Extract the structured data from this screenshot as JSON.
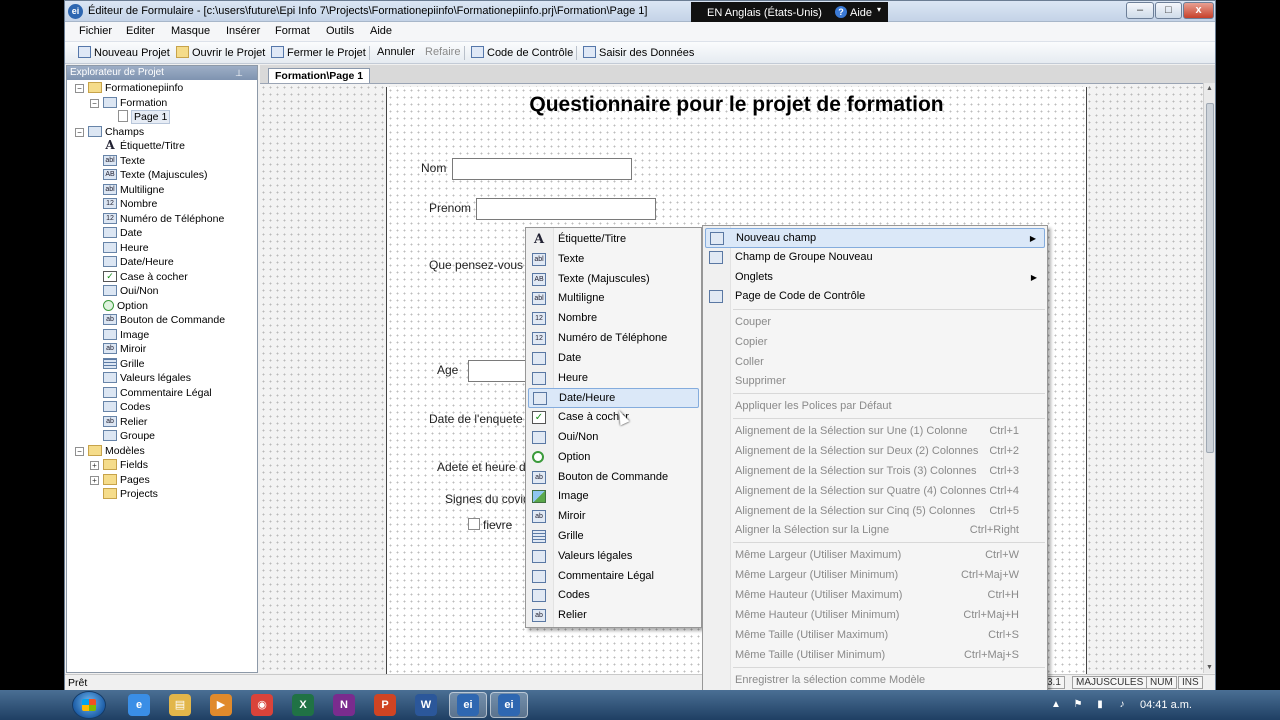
{
  "window": {
    "title": "Éditeur de Formulaire - [c:\\users\\future\\Epi Info 7\\Projects\\Formationepiinfo\\Formationepiinfo.prj\\Formation\\Page 1]",
    "app_icon_text": "ei",
    "minimize": "–",
    "maximize": "□",
    "close": "x"
  },
  "language_bar": {
    "language": "EN Anglais (États-Unis)",
    "help_label": "Aide",
    "help_icon": "?",
    "arrow": "▾"
  },
  "menubar": {
    "items": [
      "Fichier",
      "Editer",
      "Masque",
      "Insérer",
      "Format",
      "Outils",
      "Aide"
    ]
  },
  "toolbar": {
    "new_project": "Nouveau Projet",
    "open_project": "Ouvrir le Projet",
    "close_project": "Fermer le Projet",
    "undo": "Annuler",
    "redo": "Refaire",
    "check_code": "Code de Contrôle",
    "enter_data": "Saisir des Données"
  },
  "explorer": {
    "header": "Explorateur de Projet",
    "pin": "⊥",
    "tree": [
      {
        "label": "Formationepiinfo",
        "icon": "folder-icon",
        "glyph": ""
      },
      {
        "label": "Formation",
        "icon": "form-icon",
        "glyph": ""
      },
      {
        "label": "Page 1",
        "icon": "page-icon",
        "glyph": ""
      },
      {
        "label": "Champs",
        "icon": "fields-icon",
        "glyph": ""
      },
      {
        "label": "Étiquette/Titre",
        "icon": "label-icon",
        "glyph": "A"
      },
      {
        "label": "Texte",
        "icon": "text-icon",
        "glyph": "abl"
      },
      {
        "label": "Texte (Majuscules)",
        "icon": "uppercase-text-icon",
        "glyph": "AB"
      },
      {
        "label": "Multiligne",
        "icon": "multiline-icon",
        "glyph": "abl"
      },
      {
        "label": "Nombre",
        "icon": "number-icon",
        "glyph": "12"
      },
      {
        "label": "Numéro de Téléphone",
        "icon": "phone-icon",
        "glyph": "12"
      },
      {
        "label": "Date",
        "icon": "date-icon",
        "glyph": ""
      },
      {
        "label": "Heure",
        "icon": "time-icon",
        "glyph": ""
      },
      {
        "label": "Date/Heure",
        "icon": "datetime-icon",
        "glyph": ""
      },
      {
        "label": "Case à cocher",
        "icon": "checkbox-icon",
        "glyph": "✓"
      },
      {
        "label": "Oui/Non",
        "icon": "yes-no-icon",
        "glyph": ""
      },
      {
        "label": "Option",
        "icon": "option-icon",
        "glyph": ""
      },
      {
        "label": "Bouton de Commande",
        "icon": "command-button-icon",
        "glyph": "ab"
      },
      {
        "label": "Image",
        "icon": "image-icon",
        "glyph": ""
      },
      {
        "label": "Miroir",
        "icon": "mirror-icon",
        "glyph": "ab"
      },
      {
        "label": "Grille",
        "icon": "grid-icon",
        "glyph": ""
      },
      {
        "label": "Valeurs légales",
        "icon": "legal-values-icon",
        "glyph": ""
      },
      {
        "label": "Commentaire Légal",
        "icon": "comment-legal-icon",
        "glyph": ""
      },
      {
        "label": "Codes",
        "icon": "codes-icon",
        "glyph": ""
      },
      {
        "label": "Relier",
        "icon": "relate-icon",
        "glyph": "ab"
      },
      {
        "label": "Groupe",
        "icon": "group-icon",
        "glyph": ""
      },
      {
        "label": "Modèles",
        "icon": "templates-folder-icon",
        "glyph": ""
      },
      {
        "label": "Fields",
        "icon": "folder-icon",
        "glyph": ""
      },
      {
        "label": "Pages",
        "icon": "folder-icon",
        "glyph": ""
      },
      {
        "label": "Projects",
        "icon": "folder-icon",
        "glyph": ""
      }
    ]
  },
  "document": {
    "tab": "Formation\\Page 1",
    "form_title": "Questionnaire pour le projet de formation",
    "labels": {
      "nom": "Nom",
      "prenom": "Prenom",
      "que_pensez": "Que pensez-vous d",
      "age": "Age",
      "date_enquete": "Date de l'enquete",
      "adete": "Adete et heure d",
      "signes": "Signes du covid",
      "fievre": "fievre"
    }
  },
  "field_menu": {
    "items": [
      {
        "label": "Étiquette/Titre",
        "icon": "label-icon",
        "glyph": "A"
      },
      {
        "label": "Texte",
        "icon": "text-icon",
        "glyph": "abl"
      },
      {
        "label": "Texte (Majuscules)",
        "icon": "uppercase-text-icon",
        "glyph": "AB"
      },
      {
        "label": "Multiligne",
        "icon": "multiline-icon",
        "glyph": "abl"
      },
      {
        "label": "Nombre",
        "icon": "number-icon",
        "glyph": "12"
      },
      {
        "label": "Numéro de Téléphone",
        "icon": "phone-icon",
        "glyph": "12"
      },
      {
        "label": "Date",
        "icon": "date-icon",
        "glyph": ""
      },
      {
        "label": "Heure",
        "icon": "time-icon",
        "glyph": ""
      },
      {
        "label": "Date/Heure",
        "icon": "datetime-icon",
        "glyph": ""
      },
      {
        "label": "Case à cocher",
        "icon": "checkbox-icon",
        "glyph": "✓"
      },
      {
        "label": "Oui/Non",
        "icon": "yes-no-icon",
        "glyph": ""
      },
      {
        "label": "Option",
        "icon": "option-icon",
        "glyph": ""
      },
      {
        "label": "Bouton de Commande",
        "icon": "command-button-icon",
        "glyph": "ab"
      },
      {
        "label": "Image",
        "icon": "image-icon",
        "glyph": ""
      },
      {
        "label": "Miroir",
        "icon": "mirror-icon",
        "glyph": "ab"
      },
      {
        "label": "Grille",
        "icon": "grid-icon",
        "glyph": ""
      },
      {
        "label": "Valeurs légales",
        "icon": "legal-values-icon",
        "glyph": ""
      },
      {
        "label": "Commentaire Légal",
        "icon": "comment-legal-icon",
        "glyph": ""
      },
      {
        "label": "Codes",
        "icon": "codes-icon",
        "glyph": ""
      },
      {
        "label": "Relier",
        "icon": "relate-icon",
        "glyph": "ab"
      }
    ],
    "highlighted": "Date/Heure"
  },
  "context_menu": {
    "items": [
      {
        "label": "Nouveau champ",
        "shortcut": "",
        "submenu": true,
        "enabled": true,
        "highlighted": true,
        "icon": "new-field-icon"
      },
      {
        "label": "Champ de Groupe Nouveau",
        "shortcut": "",
        "submenu": false,
        "enabled": true,
        "icon": "group-field-icon"
      },
      {
        "label": "Onglets",
        "shortcut": "",
        "submenu": true,
        "enabled": true,
        "icon": ""
      },
      {
        "label": "Page de Code de Contrôle",
        "shortcut": "",
        "submenu": false,
        "enabled": true,
        "icon": "check-code-icon"
      },
      {
        "label": "Couper",
        "shortcut": "",
        "enabled": false
      },
      {
        "label": "Copier",
        "shortcut": "",
        "enabled": false
      },
      {
        "label": "Coller",
        "shortcut": "",
        "enabled": false
      },
      {
        "label": "Supprimer",
        "shortcut": "",
        "enabled": false
      },
      {
        "label": "Appliquer les Polices par Défaut",
        "shortcut": "",
        "enabled": false
      },
      {
        "label": "Alignement de la Sélection sur Une (1) Colonne",
        "shortcut": "Ctrl+1",
        "enabled": false
      },
      {
        "label": "Alignement de la Sélection sur Deux (2) Colonnes",
        "shortcut": "Ctrl+2",
        "enabled": false
      },
      {
        "label": "Alignement de la Sélection sur Trois (3) Colonnes",
        "shortcut": "Ctrl+3",
        "enabled": false
      },
      {
        "label": "Alignement de la Sélection sur Quatre (4) Colonnes",
        "shortcut": "Ctrl+4",
        "enabled": false
      },
      {
        "label": "Alignement de la Sélection sur Cinq (5) Colonnes",
        "shortcut": "Ctrl+5",
        "enabled": false
      },
      {
        "label": "Aligner la Sélection sur la Ligne",
        "shortcut": "Ctrl+Right",
        "enabled": false
      },
      {
        "label": "Même Largeur (Utiliser Maximum)",
        "shortcut": "Ctrl+W",
        "enabled": false
      },
      {
        "label": "Même Largeur (Utiliser Minimum)",
        "shortcut": "Ctrl+Maj+W",
        "enabled": false
      },
      {
        "label": "Même Hauteur (Utiliser Maximum)",
        "shortcut": "Ctrl+H",
        "enabled": false
      },
      {
        "label": "Même Hauteur (Utiliser Minimum)",
        "shortcut": "Ctrl+Maj+H",
        "enabled": false
      },
      {
        "label": "Même Taille (Utiliser Maximum)",
        "shortcut": "Ctrl+S",
        "enabled": false
      },
      {
        "label": "Même Taille (Utiliser Minimum)",
        "shortcut": "Ctrl+Maj+S",
        "enabled": false
      },
      {
        "label": "Enregistrer la sélection comme Modèle",
        "shortcut": "",
        "enabled": false
      }
    ]
  },
  "status_bar": {
    "status": "Prêt",
    "version": "3.1",
    "caps": "MAJUSCULES",
    "num": "NUM",
    "ins": "INS"
  },
  "taskbar": {
    "apps": [
      {
        "name": "internet-explorer-icon",
        "glyph": "e",
        "color": "#3a8ee6"
      },
      {
        "name": "file-explorer-icon",
        "glyph": "▤",
        "color": "#e2b64a"
      },
      {
        "name": "media-player-icon",
        "glyph": "▶",
        "color": "#e08a2c"
      },
      {
        "name": "chrome-icon",
        "glyph": "◉",
        "color": "#d9433a"
      },
      {
        "name": "excel-icon",
        "glyph": "X",
        "color": "#207245"
      },
      {
        "name": "onenote-icon",
        "glyph": "N",
        "color": "#7a2c8e"
      },
      {
        "name": "powerpoint-icon",
        "glyph": "P",
        "color": "#d04423"
      },
      {
        "name": "word-icon",
        "glyph": "W",
        "color": "#2b579a"
      },
      {
        "name": "epi-info-icon",
        "glyph": "ei",
        "color": "#2e67b1"
      },
      {
        "name": "epi-info-form-designer-icon",
        "glyph": "ei",
        "color": "#2e67b1"
      }
    ],
    "clock": "04:41 a.m.",
    "tray": [
      "▲",
      "⚑",
      "▮",
      "♪"
    ]
  }
}
